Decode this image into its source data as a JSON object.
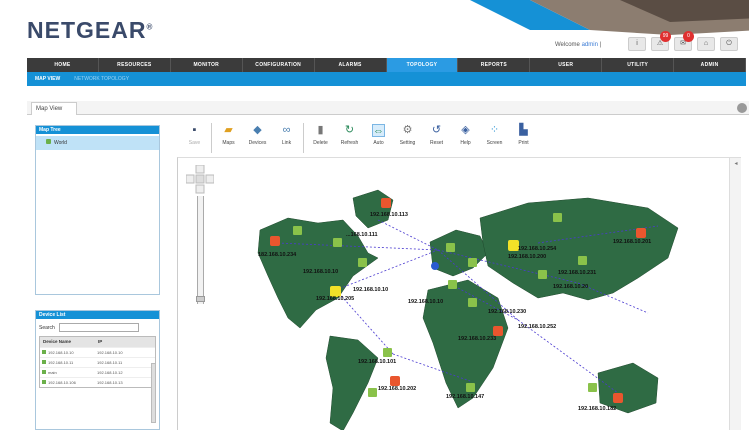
{
  "header": {
    "logo": "NETGEAR",
    "welcome": "Welcome",
    "user": "admin",
    "badges": [
      "99",
      "0"
    ]
  },
  "nav": {
    "items": [
      "HOME",
      "RESOURCES",
      "MONITOR",
      "CONFIGURATION",
      "ALARMS",
      "TOPOLOGY",
      "REPORTS",
      "USER",
      "UTILITY",
      "ADMIN"
    ],
    "active": "TOPOLOGY",
    "sub": [
      "MAP VIEW",
      "NETWORK TOPOLOGY"
    ]
  },
  "tab": {
    "label": "Map View"
  },
  "map_tree": {
    "title": "Map Tree",
    "item": "World"
  },
  "device_list": {
    "title": "Device List",
    "search_label": "Search",
    "search_value": "",
    "col_name": "Device Name",
    "col_ip": "IP",
    "rows": [
      {
        "name": "192.168.10.10",
        "ip": "192.168.10.10"
      },
      {
        "name": "192.168.10.11",
        "ip": "192.168.10.11"
      },
      {
        "name": "main",
        "ip": "192.168.10.12"
      },
      {
        "name": "192.168.10.106",
        "ip": "192.168.10.13"
      }
    ]
  },
  "toolbar": {
    "tools": [
      {
        "label": "Save",
        "icon": "floppy-icon",
        "glyph": "▪",
        "color": "#3a4a6a",
        "disabled": true
      },
      {
        "label": "Maps",
        "icon": "folder-icon",
        "glyph": "▰",
        "color": "#e0a020"
      },
      {
        "label": "Devices",
        "icon": "devices-icon",
        "glyph": "◆",
        "color": "#4a7fb0"
      },
      {
        "label": "Link",
        "icon": "link-icon",
        "glyph": "∞",
        "color": "#4a7fb0"
      },
      {
        "label": "Delete",
        "icon": "trash-icon",
        "glyph": "▮",
        "color": "#777"
      },
      {
        "label": "Refresh",
        "icon": "refresh-icon",
        "glyph": "↻",
        "color": "#2a8a5a"
      },
      {
        "label": "Auto",
        "icon": "auto-layout-icon",
        "glyph": "⇔",
        "color": "#2a8a5a",
        "active": true
      },
      {
        "label": "Setting",
        "icon": "gear-icon",
        "glyph": "⚙",
        "color": "#777"
      },
      {
        "label": "Reset",
        "icon": "reset-icon",
        "glyph": "↺",
        "color": "#3a60a0"
      },
      {
        "label": "Help",
        "icon": "help-icon",
        "glyph": "◈",
        "color": "#3a60a0"
      },
      {
        "label": "Screen",
        "icon": "fullscreen-icon",
        "glyph": "⁘",
        "color": "#3a9ad5"
      },
      {
        "label": "Print",
        "icon": "print-icon",
        "glyph": "▙",
        "color": "#3a60a0"
      }
    ]
  },
  "map": {
    "device_labels": [
      "192.168.10.113",
      "...168.10.111",
      "182.168.10.234",
      "192.168.10.10",
      "192.168.10.205",
      "192.168.10.10",
      "192.168.10.254",
      "192.168.10.200",
      "192.168.10.10",
      "192.168.10.201",
      "192.168.10.231",
      "192.168.10.252",
      "192.168.10.233",
      "192.168.10.101",
      "192.168.10.202",
      "192.168.10.147",
      "192.168.10.182",
      "192.168.10.20",
      "192.168.10.230"
    ]
  }
}
